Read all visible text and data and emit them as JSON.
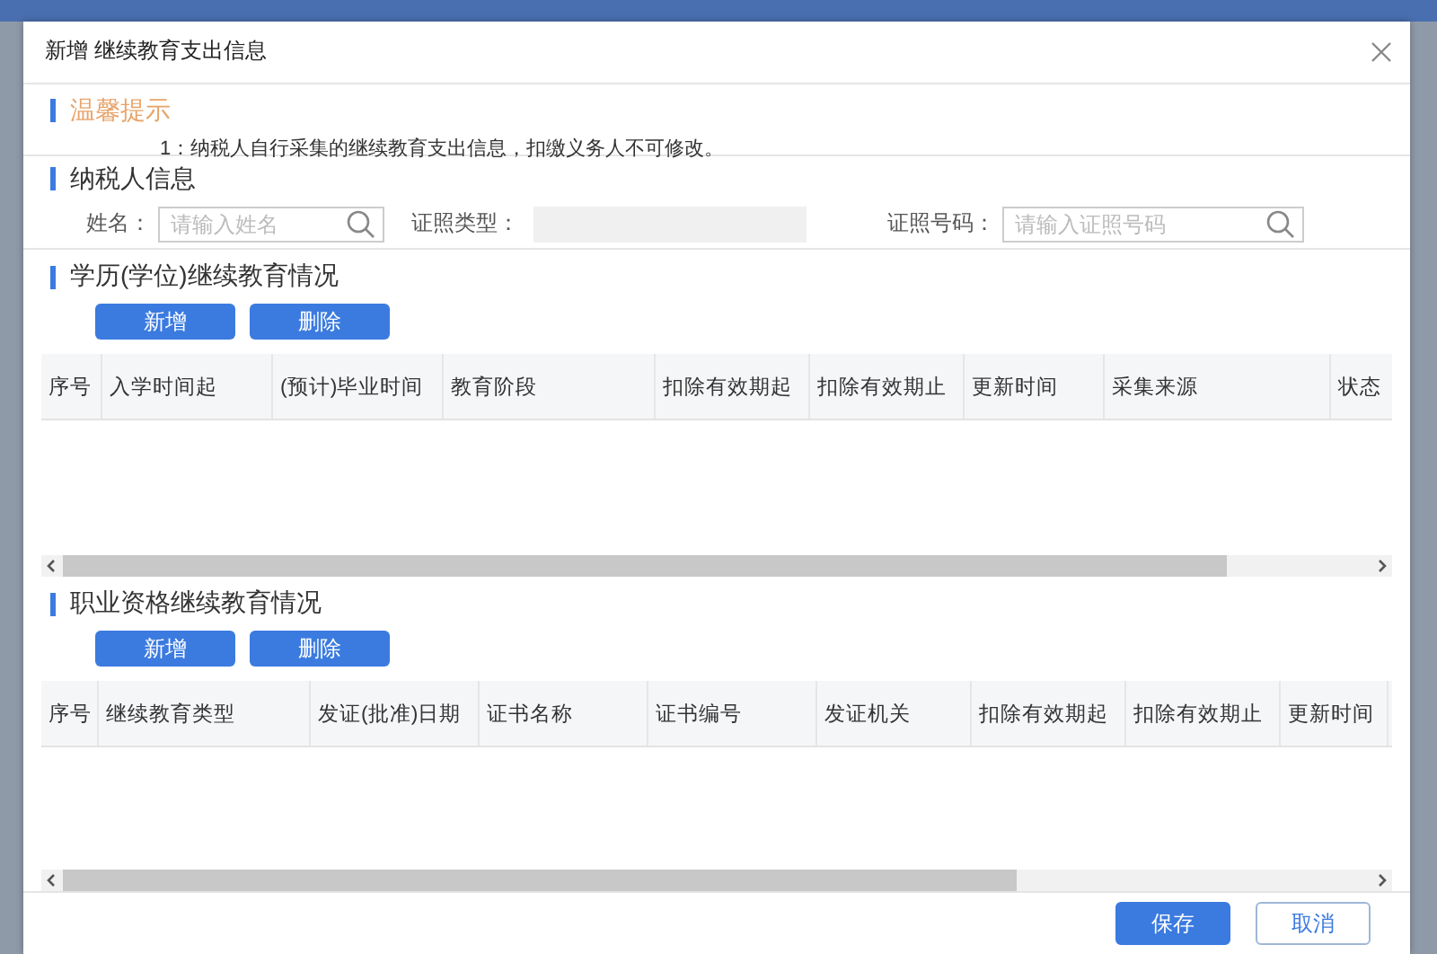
{
  "dialog": {
    "title": "新增 继续教育支出信息"
  },
  "notice": {
    "heading": "温馨提示",
    "text": "1：纳税人自行采集的继续教育支出信息，扣缴义务人不可修改。"
  },
  "taxpayer": {
    "heading": "纳税人信息",
    "fields": [
      {
        "label": "姓名：",
        "placeholder": "请输入姓名",
        "kind": "search"
      },
      {
        "label": "证照类型：",
        "kind": "select"
      },
      {
        "label": "证照号码：",
        "placeholder": "请输入证照号码",
        "kind": "search"
      }
    ]
  },
  "sections": [
    {
      "heading": "学历(学位)继续教育情况",
      "buttons": [
        "新增",
        "删除"
      ],
      "columns": [
        "序号",
        "入学时间起",
        "(预计)毕业时间",
        "教育阶段",
        "扣除有效期起",
        "扣除有效期止",
        "更新时间",
        "采集来源",
        "状态"
      ]
    },
    {
      "heading": "职业资格继续教育情况",
      "buttons": [
        "新增",
        "删除"
      ],
      "columns": [
        "序号",
        "继续教育类型",
        "发证(批准)日期",
        "证书名称",
        "证书编号",
        "发证机关",
        "扣除有效期起",
        "扣除有效期止",
        "更新时间"
      ]
    }
  ],
  "footer": {
    "buttons": [
      {
        "label": "保存",
        "kind": "primary"
      },
      {
        "label": "取消",
        "kind": "secondary"
      }
    ]
  }
}
